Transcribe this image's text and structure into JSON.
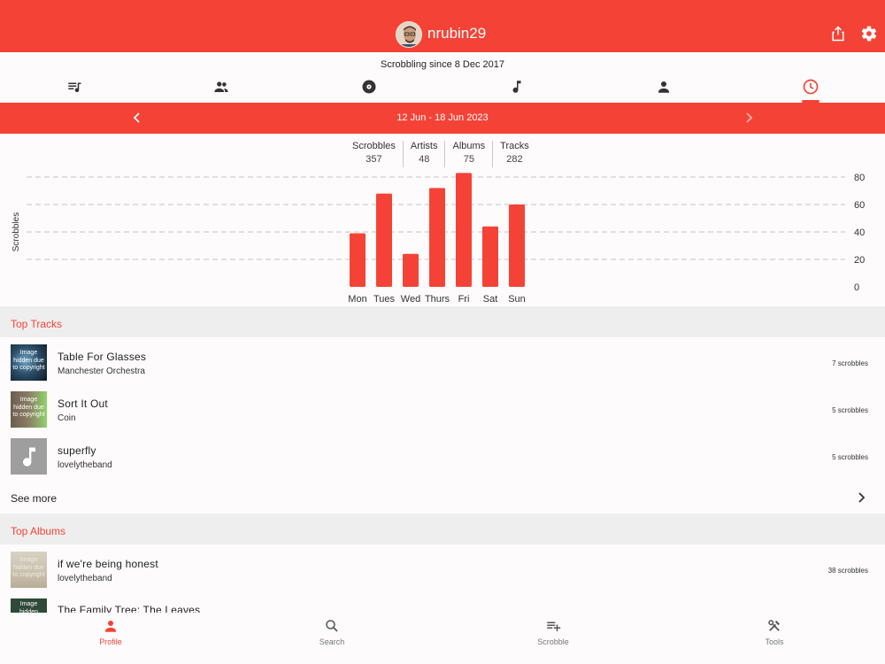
{
  "header": {
    "username": "nrubin29",
    "share_icon": "share-icon",
    "settings_icon": "gear-icon"
  },
  "profile": {
    "since": "Scrobbling since 8 Dec 2017"
  },
  "tabs": [
    {
      "name": "tab-scrobbles",
      "icon": "queue-music-icon"
    },
    {
      "name": "tab-friends",
      "icon": "people-icon"
    },
    {
      "name": "tab-albums",
      "icon": "album-icon"
    },
    {
      "name": "tab-tracks",
      "icon": "music-note-icon"
    },
    {
      "name": "tab-artists",
      "icon": "person-icon"
    },
    {
      "name": "tab-weekly-chart",
      "icon": "clock-icon",
      "active": true
    }
  ],
  "week": {
    "label": "12 Jun - 18 Jun 2023"
  },
  "stats": [
    {
      "label": "Scrobbles",
      "value": "357"
    },
    {
      "label": "Artists",
      "value": "48"
    },
    {
      "label": "Albums",
      "value": "75"
    },
    {
      "label": "Tracks",
      "value": "282"
    }
  ],
  "chart_data": {
    "type": "bar",
    "categories": [
      "Mon",
      "Tues",
      "Wed",
      "Thurs",
      "Fri",
      "Sat",
      "Sun"
    ],
    "values": [
      39,
      68,
      24,
      72,
      83,
      44,
      60
    ],
    "ylabel": "Scrobbles",
    "ylim": [
      0,
      80
    ],
    "yticks": [
      0,
      20,
      40,
      60,
      80
    ],
    "grid": true,
    "color": "#f44336"
  },
  "top_tracks": {
    "title": "Top Tracks",
    "items": [
      {
        "title": "Table For Glasses",
        "artist": "Manchester Orchestra",
        "count": "7 scrobbles",
        "image_text": "Image hidden due to copyright"
      },
      {
        "title": "Sort It Out",
        "artist": "Coin",
        "count": "5 scrobbles",
        "image_text": "Image hidden due to copyright"
      },
      {
        "title": "superfly",
        "artist": "lovelytheband",
        "count": "5 scrobbles",
        "image_text": ""
      }
    ],
    "see_more": "See more"
  },
  "top_albums": {
    "title": "Top Albums",
    "items": [
      {
        "title": "if we're being honest",
        "artist": "lovelytheband",
        "count": "38 scrobbles",
        "image_text": "Image hidden due to copyright"
      },
      {
        "title": "The Family Tree: The Leaves",
        "artist": "",
        "count": "",
        "image_text": "Image hidden"
      }
    ]
  },
  "bottom_nav": [
    {
      "label": "Profile",
      "icon": "person-icon",
      "active": true
    },
    {
      "label": "Search",
      "icon": "search-icon"
    },
    {
      "label": "Scrobble",
      "icon": "playlist-add-icon"
    },
    {
      "label": "Tools",
      "icon": "tools-icon"
    }
  ],
  "colors": {
    "accent": "#f44336",
    "section_bg": "#efeeee"
  }
}
